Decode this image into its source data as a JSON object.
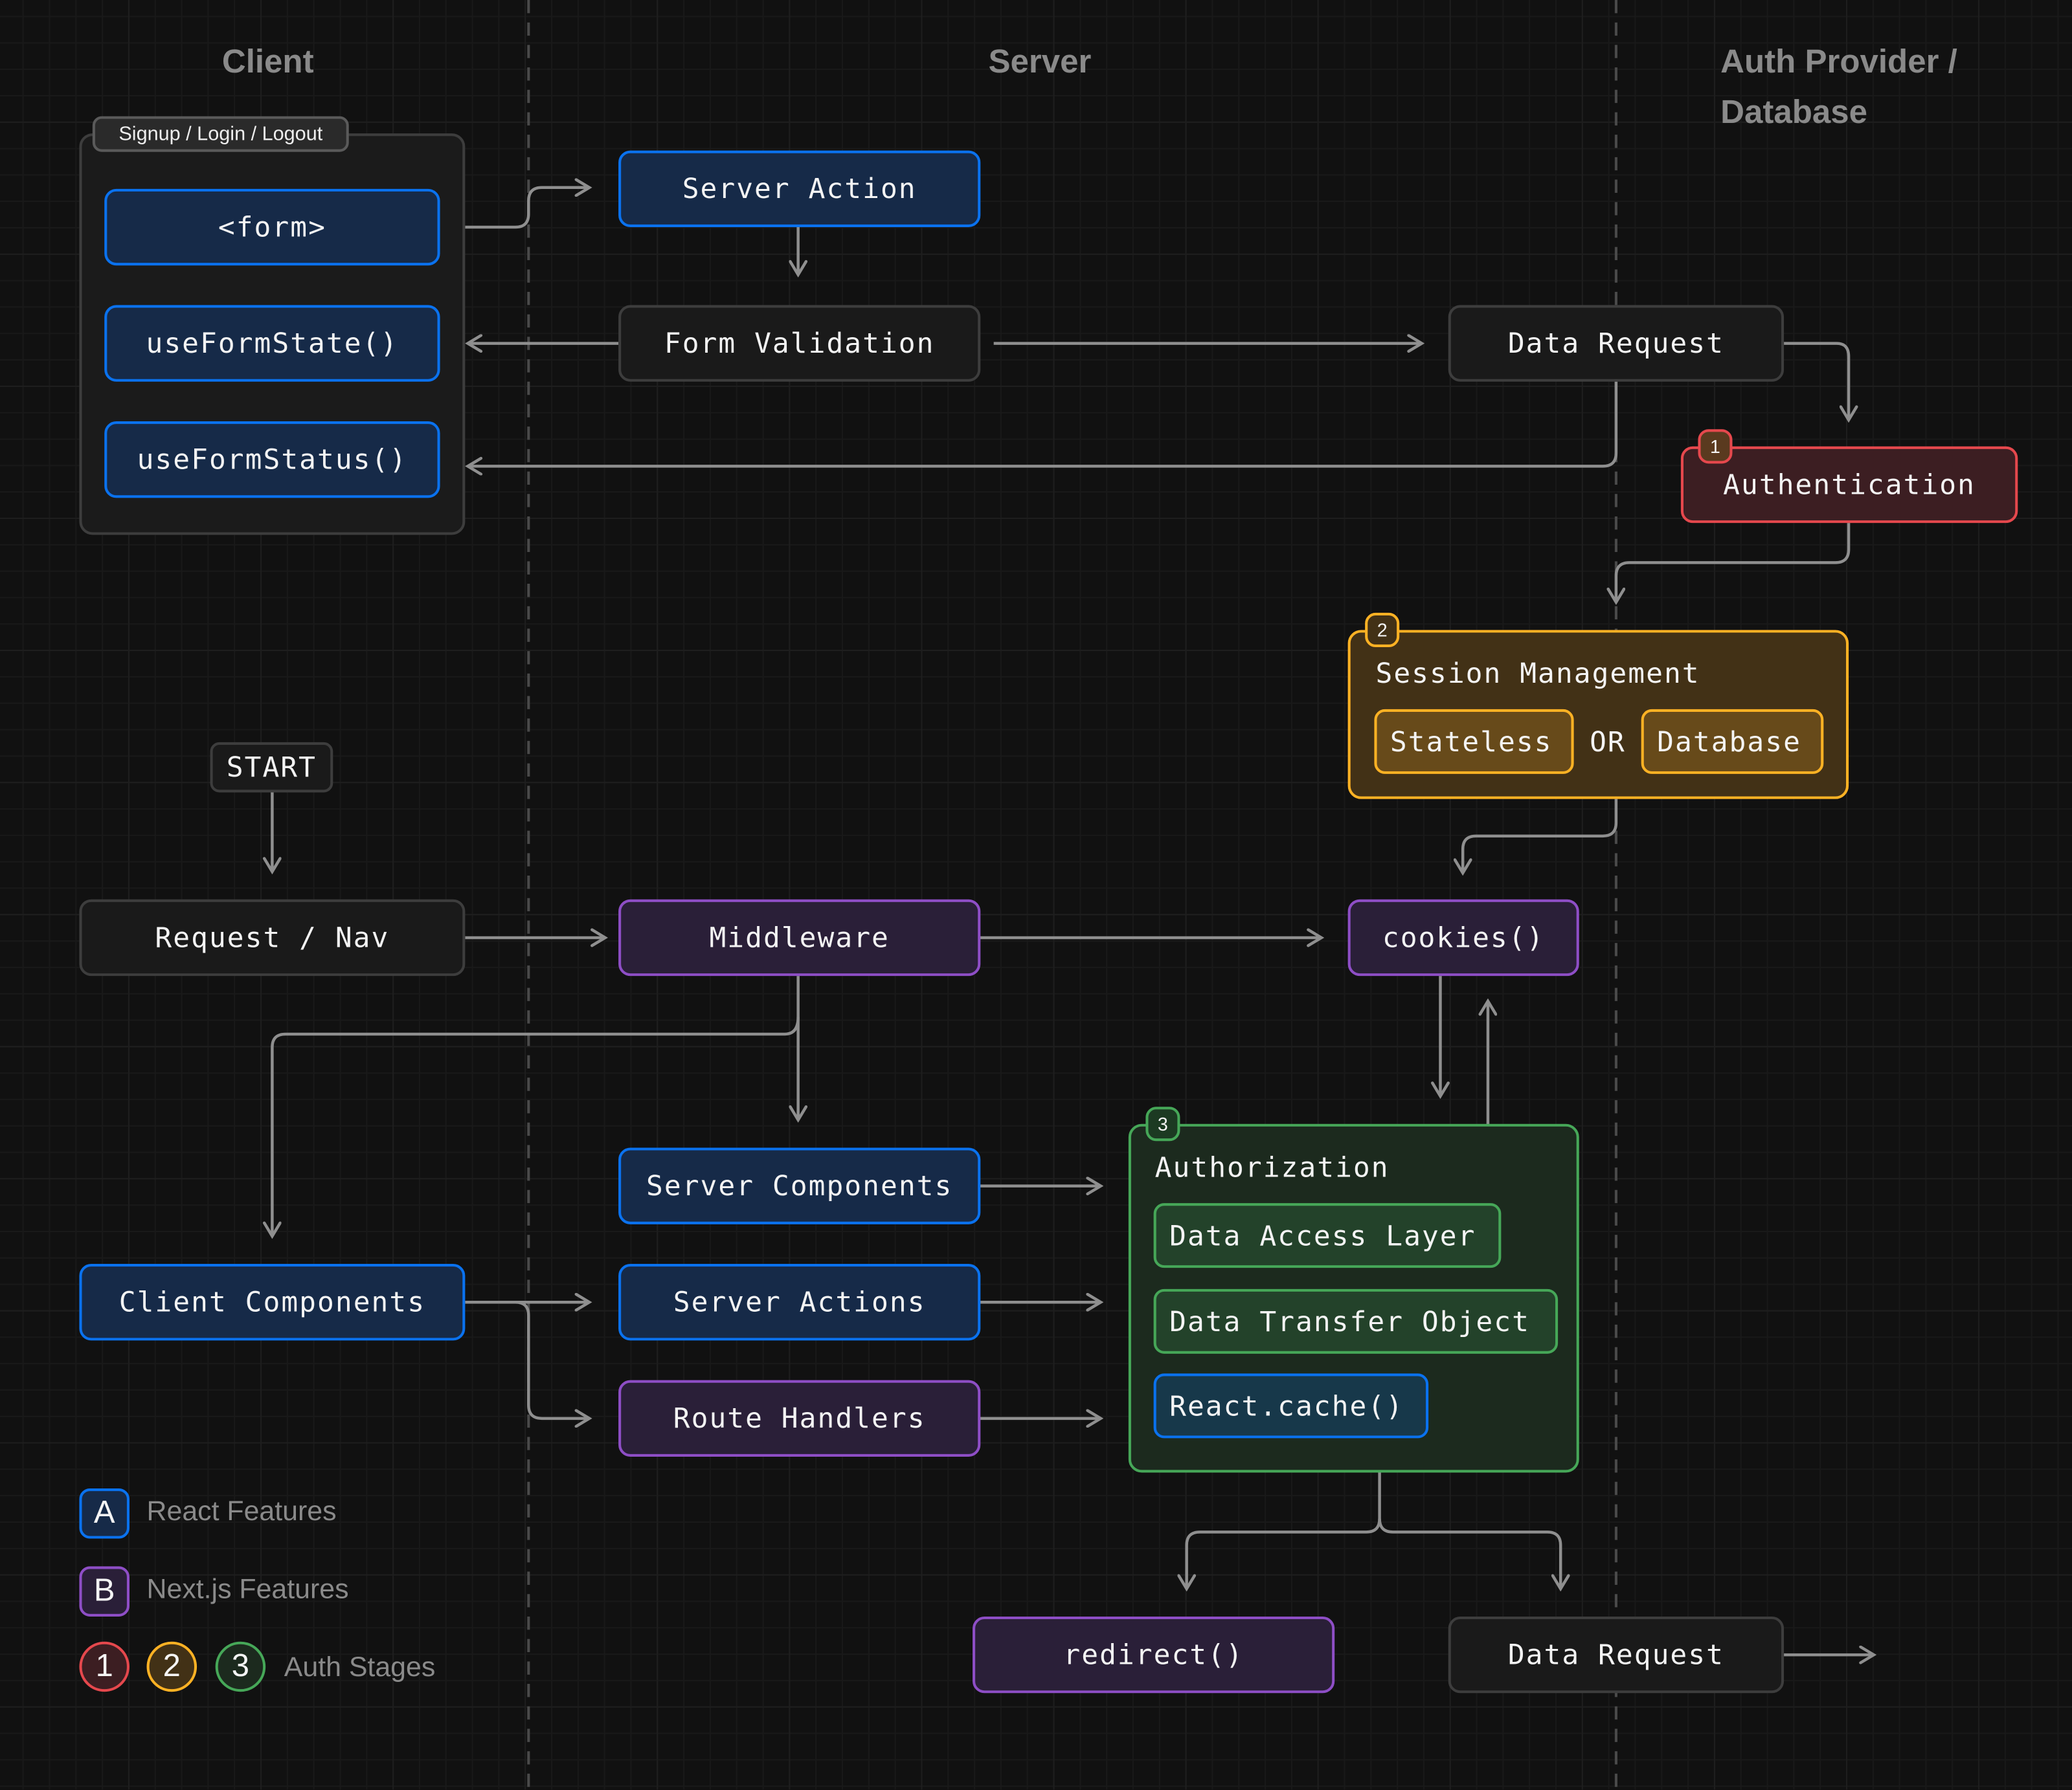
{
  "columns": {
    "client": "Client",
    "server": "Server",
    "auth_line1": "Auth Provider /",
    "auth_line2": "Database"
  },
  "client_group": {
    "label": "Signup / Login / Logout",
    "items": [
      "<form>",
      "useFormState()",
      "useFormStatus()"
    ]
  },
  "nodes": {
    "server_action": "Server Action",
    "form_validation": "Form Validation",
    "data_request_top": "Data Request",
    "authentication": "Authentication",
    "start": "START",
    "request_nav": "Request / Nav",
    "middleware": "Middleware",
    "cookies": "cookies()",
    "server_components": "Server Components",
    "client_components": "Client Components",
    "server_actions": "Server Actions",
    "route_handlers": "Route Handlers",
    "redirect": "redirect()",
    "data_request_bottom": "Data Request"
  },
  "session": {
    "badge": "2",
    "title": "Session Management",
    "option_a": "Stateless",
    "or": "OR",
    "option_b": "Database"
  },
  "authentication_badge": "1",
  "authorization": {
    "badge": "3",
    "title": "Authorization",
    "items": [
      "Data Access Layer",
      "Data Transfer Object",
      "React.cache()"
    ]
  },
  "legend": {
    "react": {
      "chip": "A",
      "label": "React Features",
      "color": "#0a72ef"
    },
    "nextjs": {
      "chip": "B",
      "label": "Next.js Features",
      "color": "#8e4ec6"
    },
    "stages": {
      "chips": [
        "1",
        "2",
        "3"
      ],
      "label": "Auth Stages",
      "colors": [
        "#e5484d",
        "#ffb224",
        "#46a758"
      ]
    }
  }
}
